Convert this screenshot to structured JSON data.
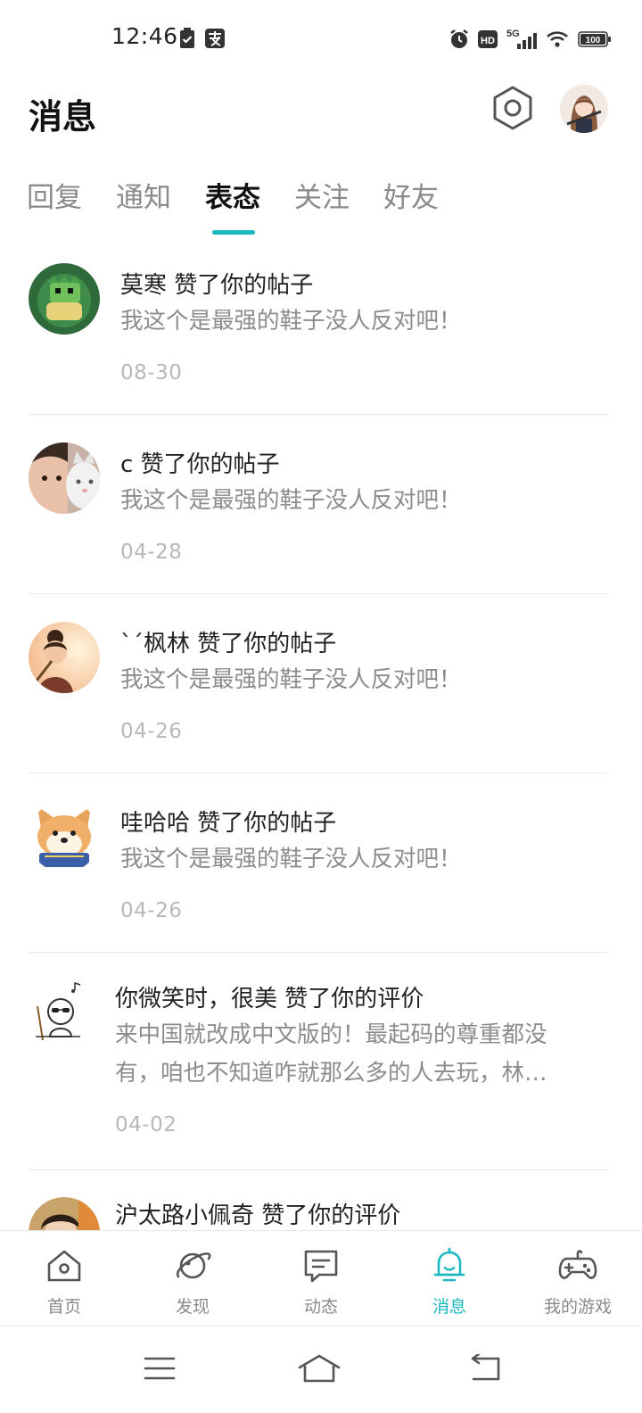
{
  "status_bar": {
    "time": "12:46",
    "network": "5G",
    "battery": "100",
    "icons": [
      "task-icon",
      "pay-icon",
      "alarm-icon",
      "hd-icon",
      "signal-icon",
      "wifi-icon",
      "battery-icon"
    ]
  },
  "header": {
    "title": "消息",
    "settings_icon": "hexagon-settings-icon"
  },
  "tabs": [
    {
      "label": "回复",
      "active": false
    },
    {
      "label": "通知",
      "active": false
    },
    {
      "label": "表态",
      "active": true
    },
    {
      "label": "关注",
      "active": false
    },
    {
      "label": "好友",
      "active": false
    }
  ],
  "accent_color": "#1bb8c0",
  "items": [
    {
      "title": "莫寒 赞了你的帖子",
      "content": "我这个是最强的鞋子没人反对吧！",
      "date": "08-30"
    },
    {
      "title": "c 赞了你的帖子",
      "content": "我这个是最强的鞋子没人反对吧！",
      "date": "04-28"
    },
    {
      "title": "`´枫林 赞了你的帖子",
      "content": "我这个是最强的鞋子没人反对吧！",
      "date": "04-26"
    },
    {
      "title": "哇哈哈 赞了你的帖子",
      "content": "我这个是最强的鞋子没人反对吧！",
      "date": "04-26"
    },
    {
      "title": "你微笑时，很美 赞了你的评价",
      "content": "来中国就改成中文版的！最起码的尊重都没有，咱也不知道咋就那么多的人去玩，林…",
      "date": "04-02"
    },
    {
      "title": "沪太路小佩奇 赞了你的评价",
      "content": "",
      "date": ""
    }
  ],
  "bottom_nav": [
    {
      "label": "首页",
      "icon": "home-icon",
      "active": false
    },
    {
      "label": "发现",
      "icon": "planet-icon",
      "active": false
    },
    {
      "label": "动态",
      "icon": "chat-icon",
      "active": false
    },
    {
      "label": "消息",
      "icon": "bell-icon",
      "active": true
    },
    {
      "label": "我的游戏",
      "icon": "gamepad-icon",
      "active": false
    }
  ],
  "system_nav": [
    "menu-icon",
    "home-outline-icon",
    "back-icon"
  ]
}
